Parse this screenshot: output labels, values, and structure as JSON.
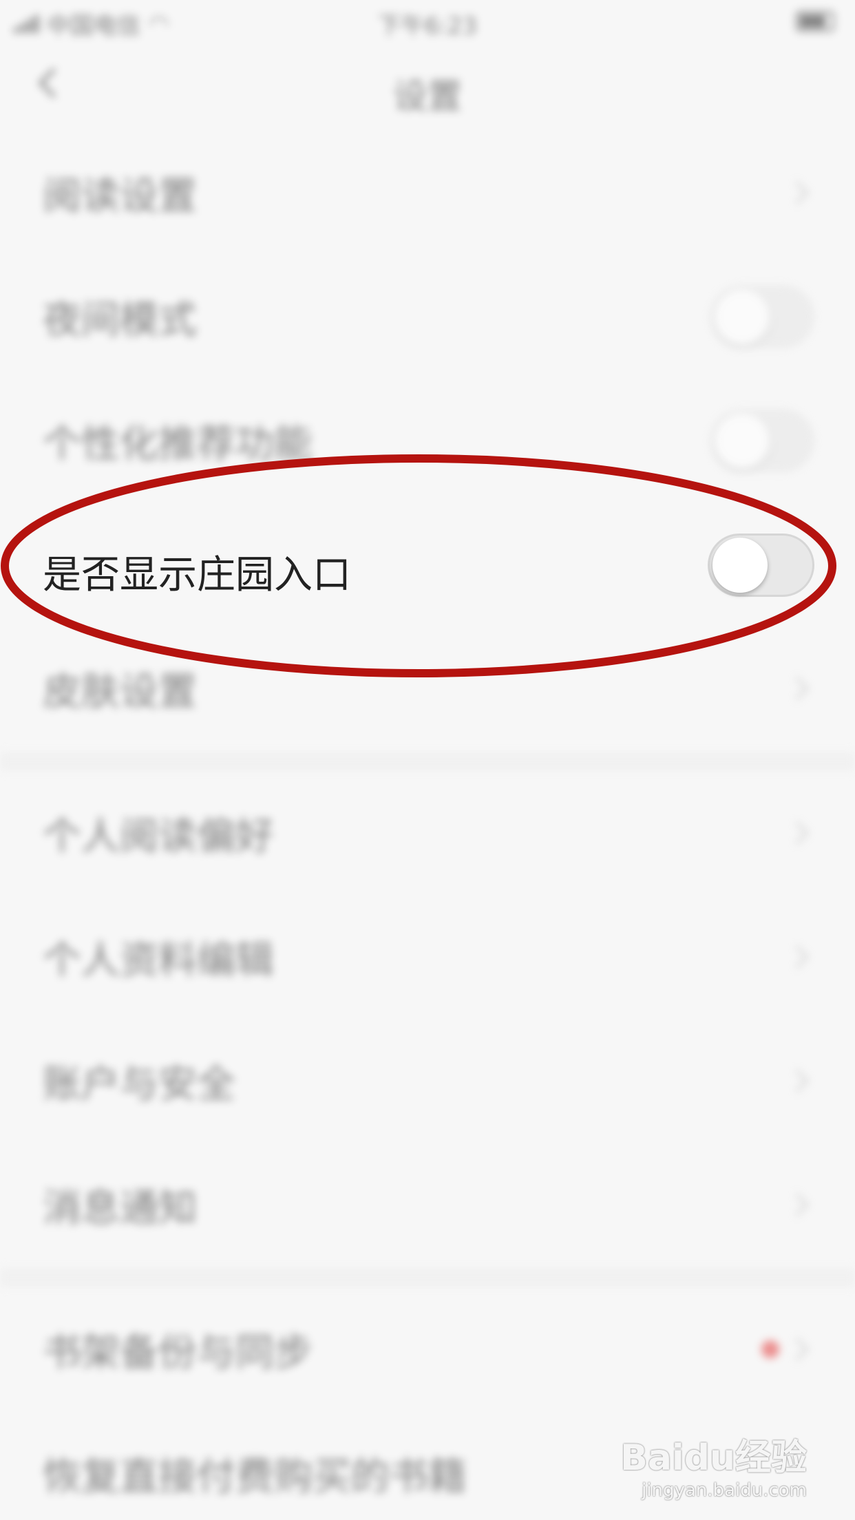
{
  "status_bar": {
    "carrier": "中国电信",
    "time": "下午6:23"
  },
  "nav": {
    "title": "设置"
  },
  "settings": {
    "reading_settings": "阅读设置",
    "night_mode": "夜间模式",
    "personalized_recommend": "个性化推荐功能",
    "show_manor_entry": "是否显示庄园入口",
    "skin_settings": "皮肤设置",
    "personal_reading_pref": "个人阅读偏好",
    "profile_edit": "个人资料编辑",
    "account_security": "账户与安全",
    "notifications": "消息通知",
    "bookshelf_backup": "书架备份与同步",
    "restore_purchases": "恢复直接付费购买的书籍"
  },
  "toggles": {
    "night_mode": "off",
    "personalized_recommend": "off",
    "show_manor_entry": "off"
  },
  "colors": {
    "highlight_ring": "#b5130f",
    "notification_dot": "#e23b3b"
  },
  "watermark": {
    "brand": "Baidu经验",
    "url": "jingyan.baidu.com"
  }
}
